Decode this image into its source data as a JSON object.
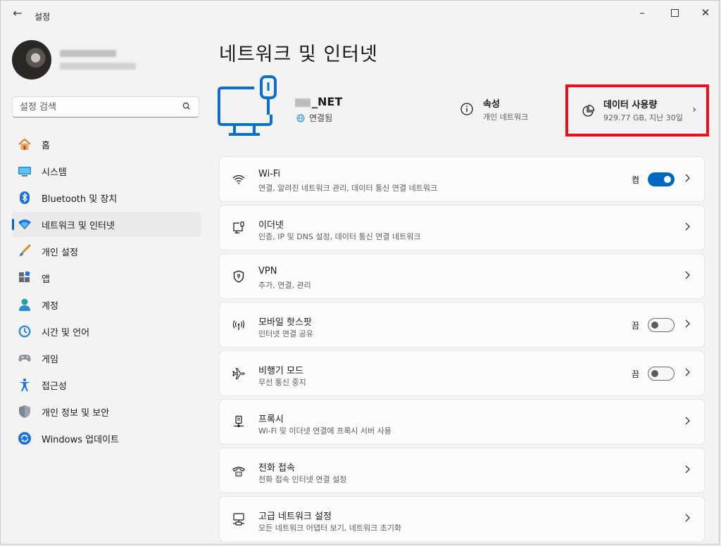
{
  "window": {
    "title": "설정",
    "back_icon": "back-arrow-icon",
    "controls": [
      "minimize-icon",
      "maximize-icon",
      "close-icon"
    ]
  },
  "search": {
    "placeholder": "설정 검색",
    "icon": "search-icon"
  },
  "sidebar": {
    "items": [
      {
        "label": "홈",
        "icon": "home-icon",
        "active": false
      },
      {
        "label": "시스템",
        "icon": "system-icon",
        "active": false
      },
      {
        "label": "Bluetooth 및 장치",
        "icon": "bluetooth-icon",
        "active": false
      },
      {
        "label": "네트워크 및 인터넷",
        "icon": "network-icon",
        "active": true
      },
      {
        "label": "개인 설정",
        "icon": "brush-icon",
        "active": false
      },
      {
        "label": "앱",
        "icon": "apps-icon",
        "active": false
      },
      {
        "label": "계정",
        "icon": "account-icon",
        "active": false
      },
      {
        "label": "시간 및 언어",
        "icon": "time-language-icon",
        "active": false
      },
      {
        "label": "게임",
        "icon": "gaming-icon",
        "active": false
      },
      {
        "label": "접근성",
        "icon": "accessibility-icon",
        "active": false
      },
      {
        "label": "개인 정보 및 보안",
        "icon": "shield-icon",
        "active": false
      },
      {
        "label": "Windows 업데이트",
        "icon": "windows-update-icon",
        "active": false
      }
    ]
  },
  "main": {
    "title": "네트워크 및 인터넷",
    "network": {
      "name": "_NET",
      "status": "연결됨"
    },
    "properties": {
      "title": "속성",
      "subtitle": "개인 네트워크"
    },
    "data_usage": {
      "title": "데이터 사용량",
      "subtitle": "929.77 GB, 지난 30일"
    },
    "cards": [
      {
        "title": "Wi-Fi",
        "subtitle": "연결, 알려진 네트워크 관리, 데이터 통신 연결 네트워크",
        "icon": "wifi-icon",
        "toggle": "on",
        "toggle_label": "켬"
      },
      {
        "title": "이더넷",
        "subtitle": "인증, IP 및 DNS 설정, 데이터 통신 연결 네트워크",
        "icon": "ethernet-icon"
      },
      {
        "title": "VPN",
        "subtitle": "추가, 연결, 관리",
        "icon": "vpn-shield-icon"
      },
      {
        "title": "모바일 핫스팟",
        "subtitle": "인터넷 연결 공유",
        "icon": "hotspot-icon",
        "toggle": "off",
        "toggle_label": "끔"
      },
      {
        "title": "비행기 모드",
        "subtitle": "무선 통신 중지",
        "icon": "airplane-icon",
        "toggle": "off",
        "toggle_label": "끔"
      },
      {
        "title": "프록시",
        "subtitle": "Wi-Fi 및 이더넷 연결에 프록시 서버 사용",
        "icon": "proxy-icon"
      },
      {
        "title": "전화 접속",
        "subtitle": "전화 접속 인터넷 연결 설정",
        "icon": "dialup-icon"
      },
      {
        "title": "고급 네트워크 설정",
        "subtitle": "모든 네트워크 어댑터 보기, 네트워크 초기화",
        "icon": "advanced-network-icon"
      }
    ]
  },
  "colors": {
    "accent": "#0067c0",
    "highlight_border": "#e8101a"
  }
}
